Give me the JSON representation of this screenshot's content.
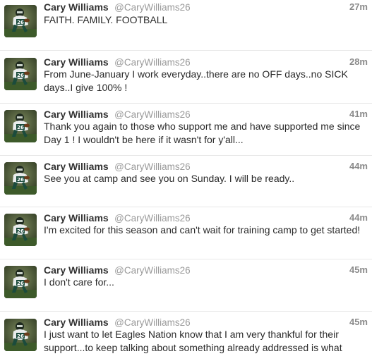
{
  "tweets": [
    {
      "name": "Cary Williams",
      "handle": "@CaryWilliams26",
      "time": "27m",
      "text": "FAITH. FAMILY. FOOTBALL",
      "avatar": "player-avatar-icon"
    },
    {
      "name": "Cary Williams",
      "handle": "@CaryWilliams26",
      "time": "28m",
      "text": "From June-January I work everyday..there are no OFF days..no SICK days..I give 100% !",
      "avatar": "player-avatar-icon"
    },
    {
      "name": "Cary Williams",
      "handle": "@CaryWilliams26",
      "time": "41m",
      "text": "Thank you again to those who support me and have supported me since Day 1 ! I wouldn't be here if it wasn't for y'all...",
      "avatar": "player-avatar-icon"
    },
    {
      "name": "Cary Williams",
      "handle": "@CaryWilliams26",
      "time": "44m",
      "text": "See you at camp and see you on Sunday. I will be ready..",
      "avatar": "player-avatar-icon"
    },
    {
      "name": "Cary Williams",
      "handle": "@CaryWilliams26",
      "time": "44m",
      "text": "I'm excited for this season and can't wait for training camp to get started!",
      "avatar": "player-avatar-icon"
    },
    {
      "name": "Cary Williams",
      "handle": "@CaryWilliams26",
      "time": "45m",
      "text": "I don't care for...",
      "avatar": "player-avatar-icon"
    },
    {
      "name": "Cary Williams",
      "handle": "@CaryWilliams26",
      "time": "45m",
      "text": "I just want to let Eagles Nation know that I am very thankful for their support...to keep talking about something already addressed is what",
      "avatar": "player-avatar-icon"
    }
  ]
}
